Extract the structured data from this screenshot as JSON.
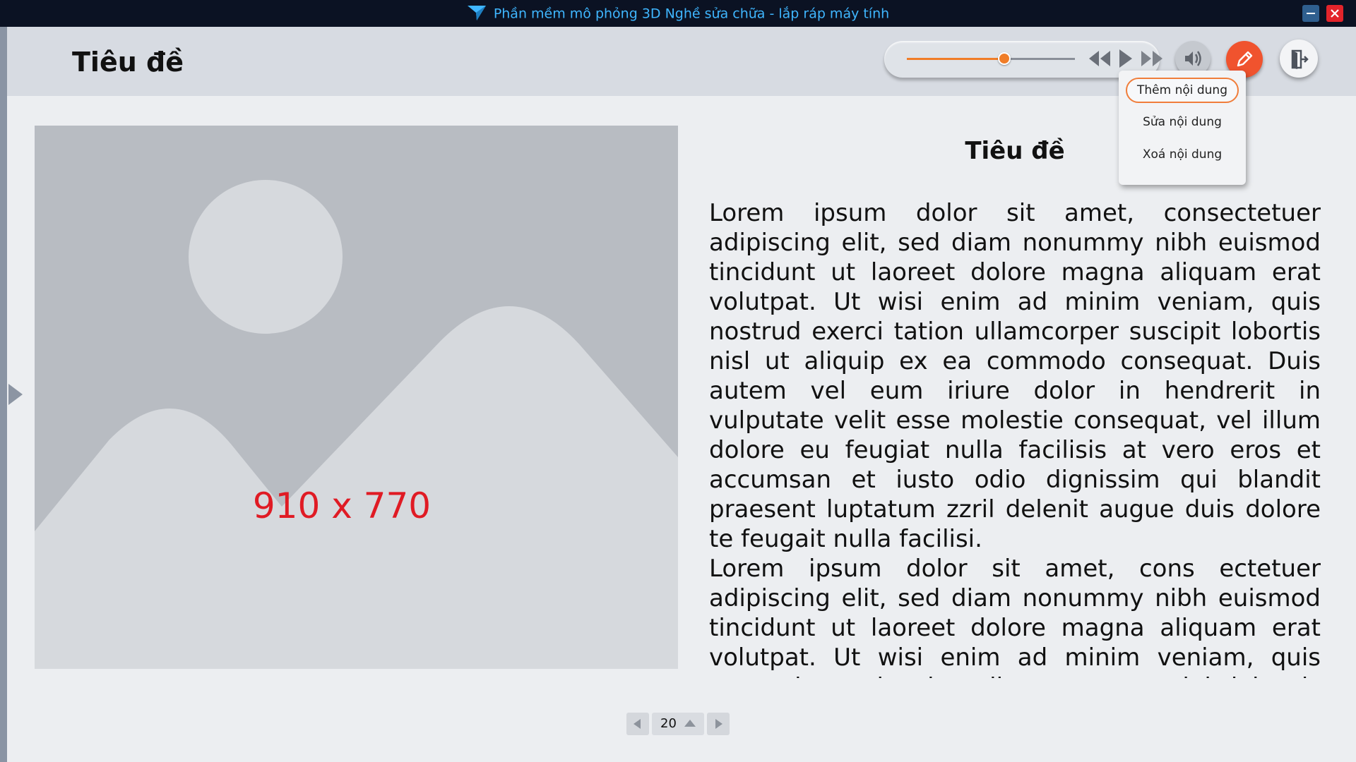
{
  "window": {
    "title": "Phần mềm mô phỏng 3D Nghề sửa chữa - lắp ráp máy tính",
    "title_color": "#3fb6ff",
    "minimize_icon": "minimize-icon",
    "close_icon": "close-icon"
  },
  "header": {
    "title": "Tiêu đề",
    "media": {
      "volume_level": 0.58,
      "accent": "#f07d28",
      "icons": [
        "rewind-icon",
        "play-icon",
        "fast-forward-icon",
        "volume-icon"
      ]
    },
    "edit_icon": "pencil-icon",
    "exit_icon": "exit-door-icon"
  },
  "dropdown": {
    "items": [
      {
        "label": "Thêm nội dung",
        "selected": true
      },
      {
        "label": "Sửa nội dung",
        "selected": false
      },
      {
        "label": "Xoá nội dung",
        "selected": false
      }
    ]
  },
  "image_placeholder": {
    "label": "910 x 770",
    "label_color": "#e01b24"
  },
  "article": {
    "title": "Tiêu đề",
    "paragraphs": [
      "Lorem ipsum dolor sit amet, consectetuer adipiscing elit, sed diam nonummy nibh euismod tincidunt ut laoreet dolore magna aliquam erat volutpat. Ut wisi enim ad minim veniam, quis nostrud exerci tation ullamcorper suscipit lobortis nisl ut aliquip ex ea commodo consequat. Duis autem vel eum iriure dolor in hendrerit in vulputate velit esse molestie consequat, vel illum dolore eu feugiat nulla facilisis at vero eros et accumsan et iusto odio dignissim qui blandit praesent luptatum zzril delenit augue duis dolore te feugait nulla facilisi.",
      "Lorem ipsum dolor sit amet, cons ectetuer adipiscing elit, sed diam nonummy nibh euismod tincidunt ut laoreet dolore magna aliquam erat volutpat. Ut wisi enim ad minim veniam, quis nostrud exerci tation ullamcorper suscipit lobortis nisl ut aliquip ex ea commodo consequat."
    ]
  },
  "pagination": {
    "page": "20"
  }
}
